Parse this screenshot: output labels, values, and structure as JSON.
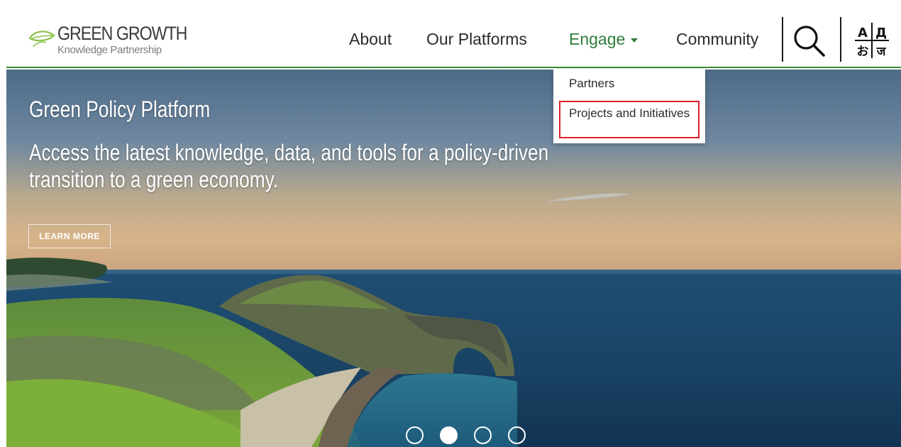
{
  "logo": {
    "title": "GREEN GROWTH",
    "subtitle": "Knowledge Partnership",
    "leaf_color": "#8bc34a"
  },
  "nav": {
    "items": [
      {
        "label": "About"
      },
      {
        "label": "Our Platforms"
      },
      {
        "label": "Engage"
      },
      {
        "label": "Community"
      }
    ],
    "active_color": "#2e7d3a",
    "search_icon": "magnifier-icon",
    "language_icon": "language-switch-icon",
    "language_glyphs": [
      "A",
      "Д",
      "お",
      "ज"
    ]
  },
  "dropdown": {
    "items": [
      {
        "label": "Partners"
      },
      {
        "label": "Projects and Initiatives"
      }
    ],
    "highlight_color": "#e0202a"
  },
  "hero": {
    "title": "Green Policy Platform",
    "subtitle": "Access the latest knowledge, data, and tools for a policy-driven transition to a green economy.",
    "cta_label": "LEARN MORE",
    "slides_total": 4,
    "active_slide": 2
  }
}
